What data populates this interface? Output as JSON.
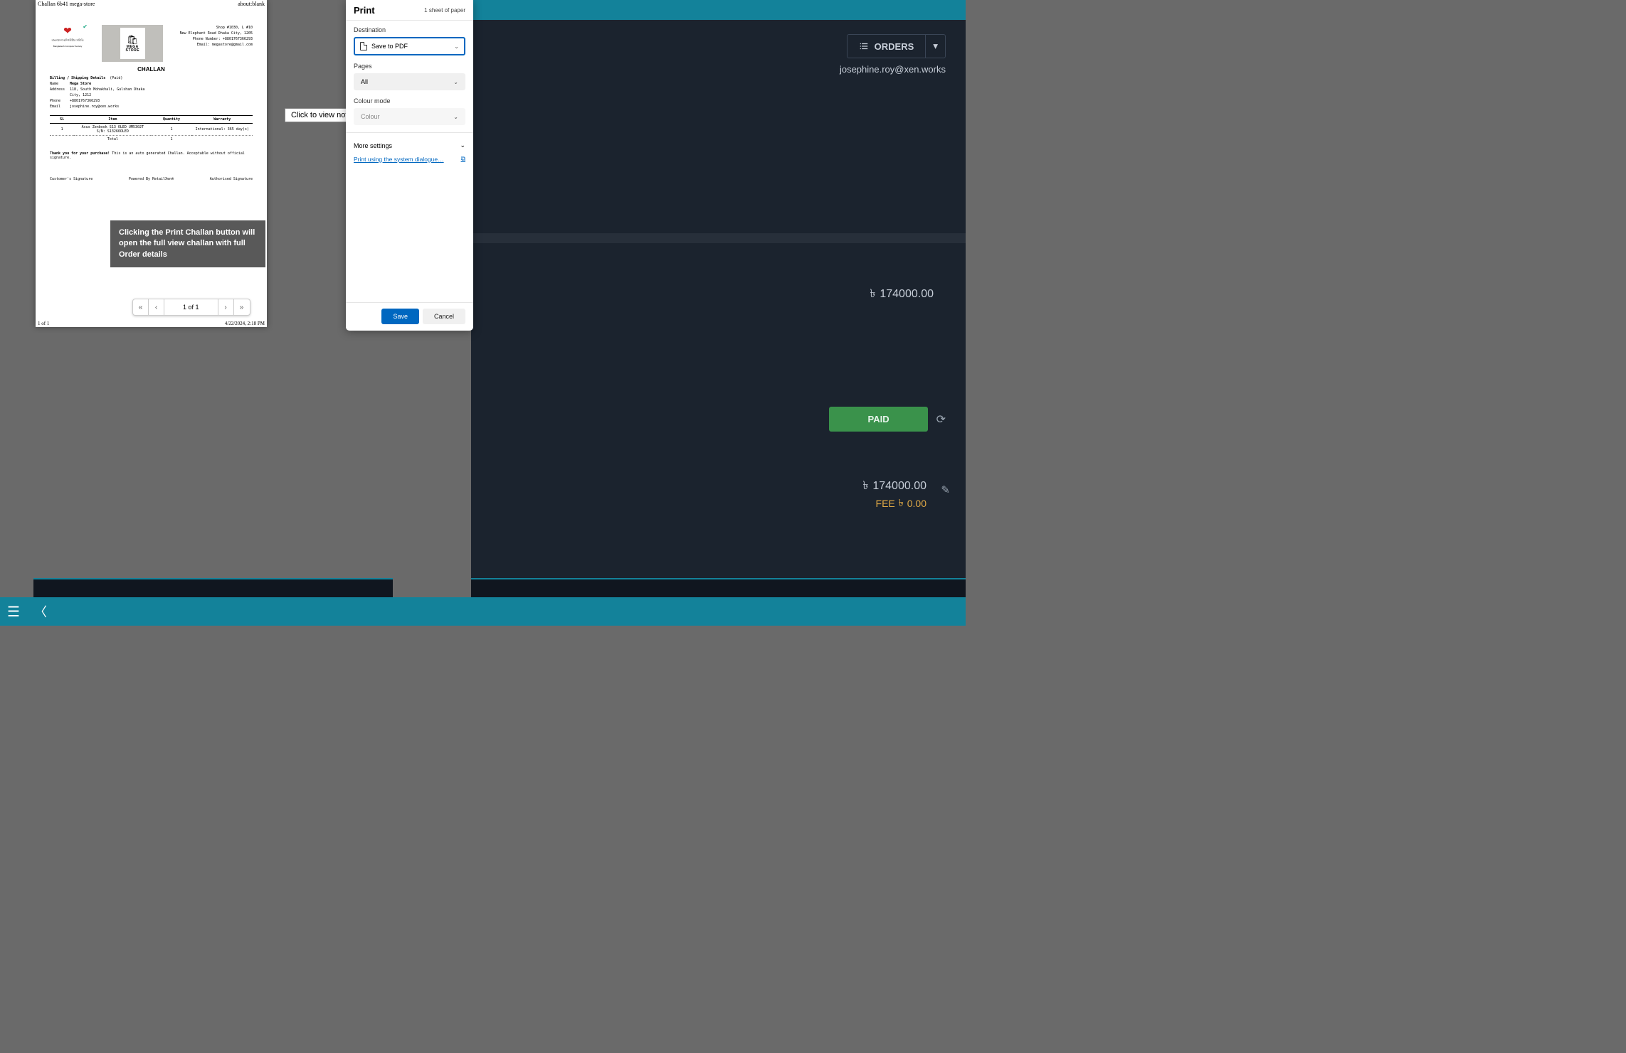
{
  "app": {
    "orders_button": "ORDERS",
    "user_email": "josephine.roy@xen.works",
    "amount_primary": "174000.00",
    "paid_badge": "PAID",
    "amount_secondary": "174000.00",
    "fee_label": "FEE",
    "fee_value": "0.00",
    "currency_glyph": "৳"
  },
  "note_tooltip": "Click to view note",
  "preview": {
    "tab_title": "Challan 6b41 mega-store",
    "url": "about:blank",
    "footer_pages": "1 of 1",
    "footer_datetime": "4/22/2024, 2:18 PM",
    "pager_text": "1 of 1"
  },
  "challan": {
    "logo_sub": "Bangladesh Computer Society",
    "logo_bangla": "বাংলাদেশ কম্পিউটার সমিতি",
    "store_label_mega": "MEGA",
    "store_label_store": "STORE",
    "store_info_line1": "Shop #1030, L #10",
    "store_info_line2": "New Elephant Road Dhaka City, 1205",
    "store_info_line3": "Phone Number: +8801767366293",
    "store_info_line4": "Email: megastore@gmail.com",
    "title": "CHALLAN",
    "billing_header": "Billing / Shipping Details",
    "paid_tag": "(Paid)",
    "name_label": "Name",
    "name_value": "Mega Store",
    "address_label": "Address",
    "address_value1": "118, South Mohakhali, Gulshan Dhaka",
    "address_value2": "City, 1212",
    "phone_label": "Phone",
    "phone_value": "+8801767366293",
    "email_label": "Email",
    "email_value": "josephine.roy@xen.works",
    "col_sl": "SL",
    "col_item": "Item",
    "col_qty": "Quantity",
    "col_warranty": "Warranty",
    "row1_sl": "1",
    "row1_item_line1": "Asus Zenbook S13 OLED UM5302T",
    "row1_item_line2": "S/N: S13266OLED",
    "row1_qty": "1",
    "row1_warranty": "International: 365 day(s)",
    "total_label": "Total",
    "total_qty": "1",
    "thank_bold": "Thank you for your purchase!",
    "thank_rest": " This is an auto generated Challan. Acceptable without official signature.",
    "sig_customer": "Customer's Signature",
    "sig_powered": "Powered By RetailXen®",
    "sig_auth": "Authorised Signature"
  },
  "callout": "Clicking the Print Challan button will open the full view challan with full Order details",
  "print": {
    "title": "Print",
    "sheets": "1 sheet of paper",
    "dest_label": "Destination",
    "dest_value": "Save to PDF",
    "pages_label": "Pages",
    "pages_value": "All",
    "colour_label": "Colour mode",
    "colour_value": "Colour",
    "more_settings": "More settings",
    "system_link": "Print using the system dialogue…",
    "save_btn": "Save",
    "cancel_btn": "Cancel"
  }
}
